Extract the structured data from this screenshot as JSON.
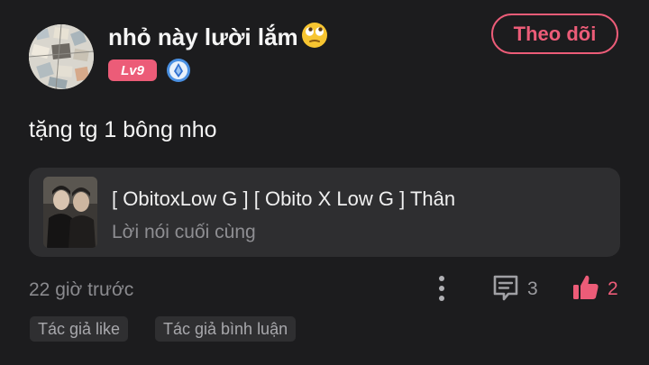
{
  "post": {
    "username": "nhỏ này lười lắm",
    "username_emoji": "face-with-rolling-eyes",
    "level": "Lv9",
    "follow_label": "Theo dõi",
    "content": "tặng tg 1 bông nho",
    "quote": {
      "title": "[ ObitoxLow G ] [ Obito X Low G ] Thân",
      "subtitle": "Lời nói cuối cùng"
    },
    "timestamp": "22 giờ trước",
    "comment_count": "3",
    "like_count": "2",
    "tags": [
      "Tác giả like",
      "Tác giả bình luận"
    ]
  },
  "colors": {
    "background": "#1c1c1e",
    "accent": "#ec5c78",
    "card": "#2e2e30",
    "muted_text": "#8a8a8e"
  },
  "icons": [
    "avatar",
    "rolling-eyes-emoji",
    "level-badge",
    "medal-icon",
    "more-vertical-icon",
    "comment-icon",
    "thumbs-up-icon"
  ]
}
